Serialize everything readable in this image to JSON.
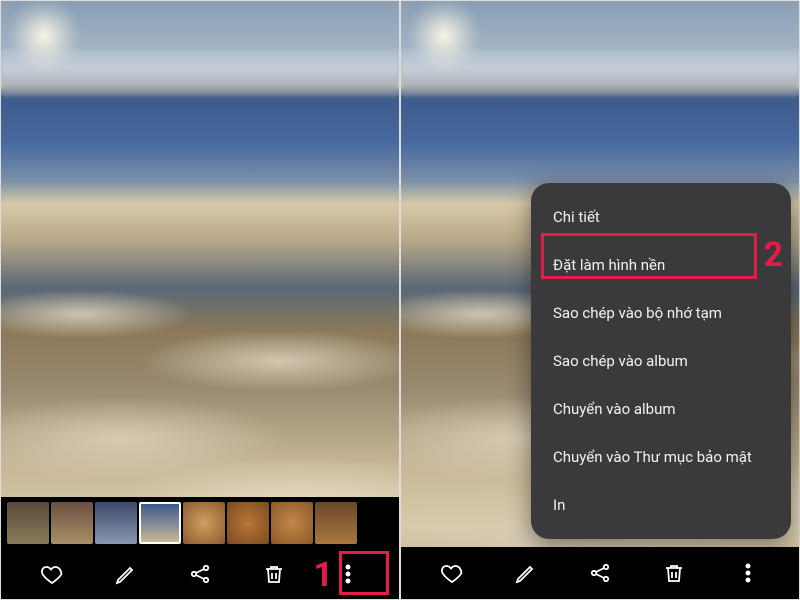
{
  "left": {
    "step_number": "1",
    "thumbs_count": 8,
    "actions": {
      "favorite": "heart-icon",
      "edit": "pencil-icon",
      "share": "share-icon",
      "delete": "trash-icon",
      "more": "more-vertical-icon"
    }
  },
  "right": {
    "step_number": "2",
    "menu": {
      "items": [
        "Chi tiết",
        "Đặt làm hình nền",
        "Sao chép vào bộ nhớ tạm",
        "Sao chép vào album",
        "Chuyển vào album",
        "Chuyển vào Thư mục bảo mật",
        "In"
      ],
      "highlighted_index": 1
    },
    "actions": {
      "favorite": "heart-icon",
      "edit": "pencil-icon",
      "share": "share-icon",
      "delete": "trash-icon",
      "more": "more-vertical-icon"
    }
  },
  "colors": {
    "highlight": "#e61b4a",
    "menu_bg": "#3a3a3c"
  }
}
